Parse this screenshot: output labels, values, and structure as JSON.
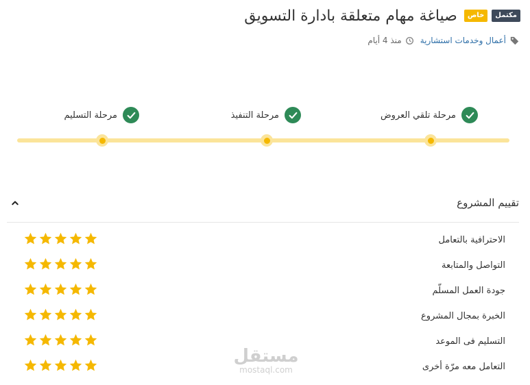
{
  "header": {
    "badge_closed": "مكتمل",
    "badge_private": "خاص",
    "title": "صياغة مهام متعلقة بادارة التسويق"
  },
  "meta": {
    "category": "أعمال وخدمات استشارية",
    "time": "منذ 4 أيام",
    "icons": [
      "tag-icon",
      "clock-icon"
    ]
  },
  "stages": [
    {
      "label": "مرحلة تلقي العروض",
      "done": true
    },
    {
      "label": "مرحلة التنفيذ",
      "done": true
    },
    {
      "label": "مرحلة التسليم",
      "done": true
    }
  ],
  "rating": {
    "title": "تقييم المشروع",
    "rows": [
      {
        "label": "الاحترافية بالتعامل",
        "stars": 5
      },
      {
        "label": "التواصل والمتابعة",
        "stars": 5
      },
      {
        "label": "جودة العمل المسلّم",
        "stars": 5
      },
      {
        "label": "الخبرة بمجال المشروع",
        "stars": 5
      },
      {
        "label": "التسليم فى الموعد",
        "stars": 5
      },
      {
        "label": "التعامل معه مرّة أخرى",
        "stars": 5
      }
    ]
  },
  "watermark": {
    "logo": "مستقل",
    "domain": "mostaql.com"
  },
  "colors": {
    "accent_yellow": "#f5b800",
    "track": "#fbe49a",
    "check_green": "#2e8a57",
    "badge_dark": "#3e4a5a",
    "link_blue": "#2e6fa8"
  }
}
